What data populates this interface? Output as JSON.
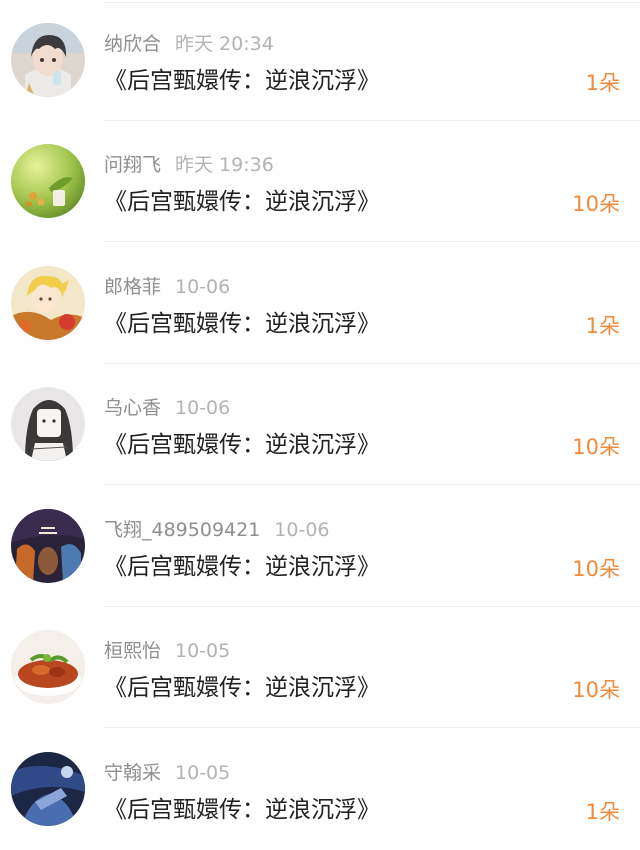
{
  "items": [
    {
      "name": "纳欣合",
      "time": "昨天 20:34",
      "title": "《后宫甄嬛传：逆浪沉浮》",
      "count": "1朵",
      "avatar": "anime-boy-avatar"
    },
    {
      "name": "问翔飞",
      "time": "昨天 19:36",
      "title": "《后宫甄嬛传：逆浪沉浮》",
      "count": "10朵",
      "avatar": "green-plant-avatar"
    },
    {
      "name": "郎格菲",
      "time": "10-06",
      "title": "《后宫甄嬛传：逆浪沉浮》",
      "count": "1朵",
      "avatar": "blonde-anime-avatar"
    },
    {
      "name": "乌心香",
      "time": "10-06",
      "title": "《后宫甄嬛传：逆浪沉浮》",
      "count": "10朵",
      "avatar": "sketch-girl-avatar"
    },
    {
      "name": "飞翔_489509421",
      "time": "10-06",
      "title": "《后宫甄嬛传：逆浪沉浮》",
      "count": "10朵",
      "avatar": "poster-art-avatar"
    },
    {
      "name": "桓熙怡",
      "time": "10-05",
      "title": "《后宫甄嬛传：逆浪沉浮》",
      "count": "10朵",
      "avatar": "food-bowl-avatar"
    },
    {
      "name": "守翰采",
      "time": "10-05",
      "title": "《后宫甄嬛传：逆浪沉浮》",
      "count": "1朵",
      "avatar": "dark-blue-art-avatar"
    }
  ],
  "colors": {
    "accent": "#f08a3c",
    "name_gray": "#8f8f8f",
    "time_gray": "#b3b3b3",
    "title_text": "#222222"
  }
}
